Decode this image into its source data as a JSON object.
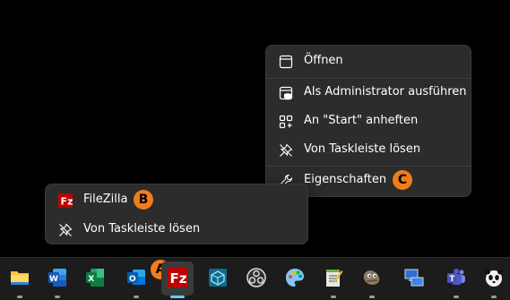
{
  "jump_list": {
    "items": [
      {
        "label": "Öffnen",
        "icon": "window-icon"
      },
      {
        "label": "Als Administrator ausführen",
        "icon": "admin-shield-icon"
      },
      {
        "label": "An \"Start\" anheften",
        "icon": "pin-to-start-icon"
      },
      {
        "label": "Von Taskleiste lösen",
        "icon": "unpin-icon"
      },
      {
        "label": "Eigenschaften",
        "icon": "wrench-icon"
      }
    ],
    "badge": "C"
  },
  "taskbar_menu": {
    "items": [
      {
        "label": "FileZilla",
        "icon": "filezilla-icon"
      },
      {
        "label": "Von Taskleiste lösen",
        "icon": "unpin-icon"
      }
    ],
    "badge": "B"
  },
  "taskbar": {
    "badge": "A",
    "apps": [
      {
        "name": "File Explorer",
        "icon": "folder-icon"
      },
      {
        "name": "Word",
        "icon": "word-icon"
      },
      {
        "name": "Excel",
        "icon": "excel-icon"
      },
      {
        "name": "Outlook",
        "icon": "outlook-icon"
      },
      {
        "name": "FileZilla",
        "icon": "filezilla-icon",
        "active": true
      },
      {
        "name": "App",
        "icon": "cube-icon"
      },
      {
        "name": "OBS",
        "icon": "obs-icon"
      },
      {
        "name": "Paint",
        "icon": "palette-icon"
      },
      {
        "name": "Notepad",
        "icon": "notepad-icon"
      },
      {
        "name": "GIMP",
        "icon": "gimp-icon"
      },
      {
        "name": "Network",
        "icon": "computer-icon"
      },
      {
        "name": "Teams",
        "icon": "teams-icon"
      },
      {
        "name": "Panda",
        "icon": "panda-icon"
      }
    ]
  },
  "colors": {
    "badge": "#f07d1a",
    "menu_bg": "#2c2c2c",
    "taskbar_bg": "#1c1c1c"
  }
}
